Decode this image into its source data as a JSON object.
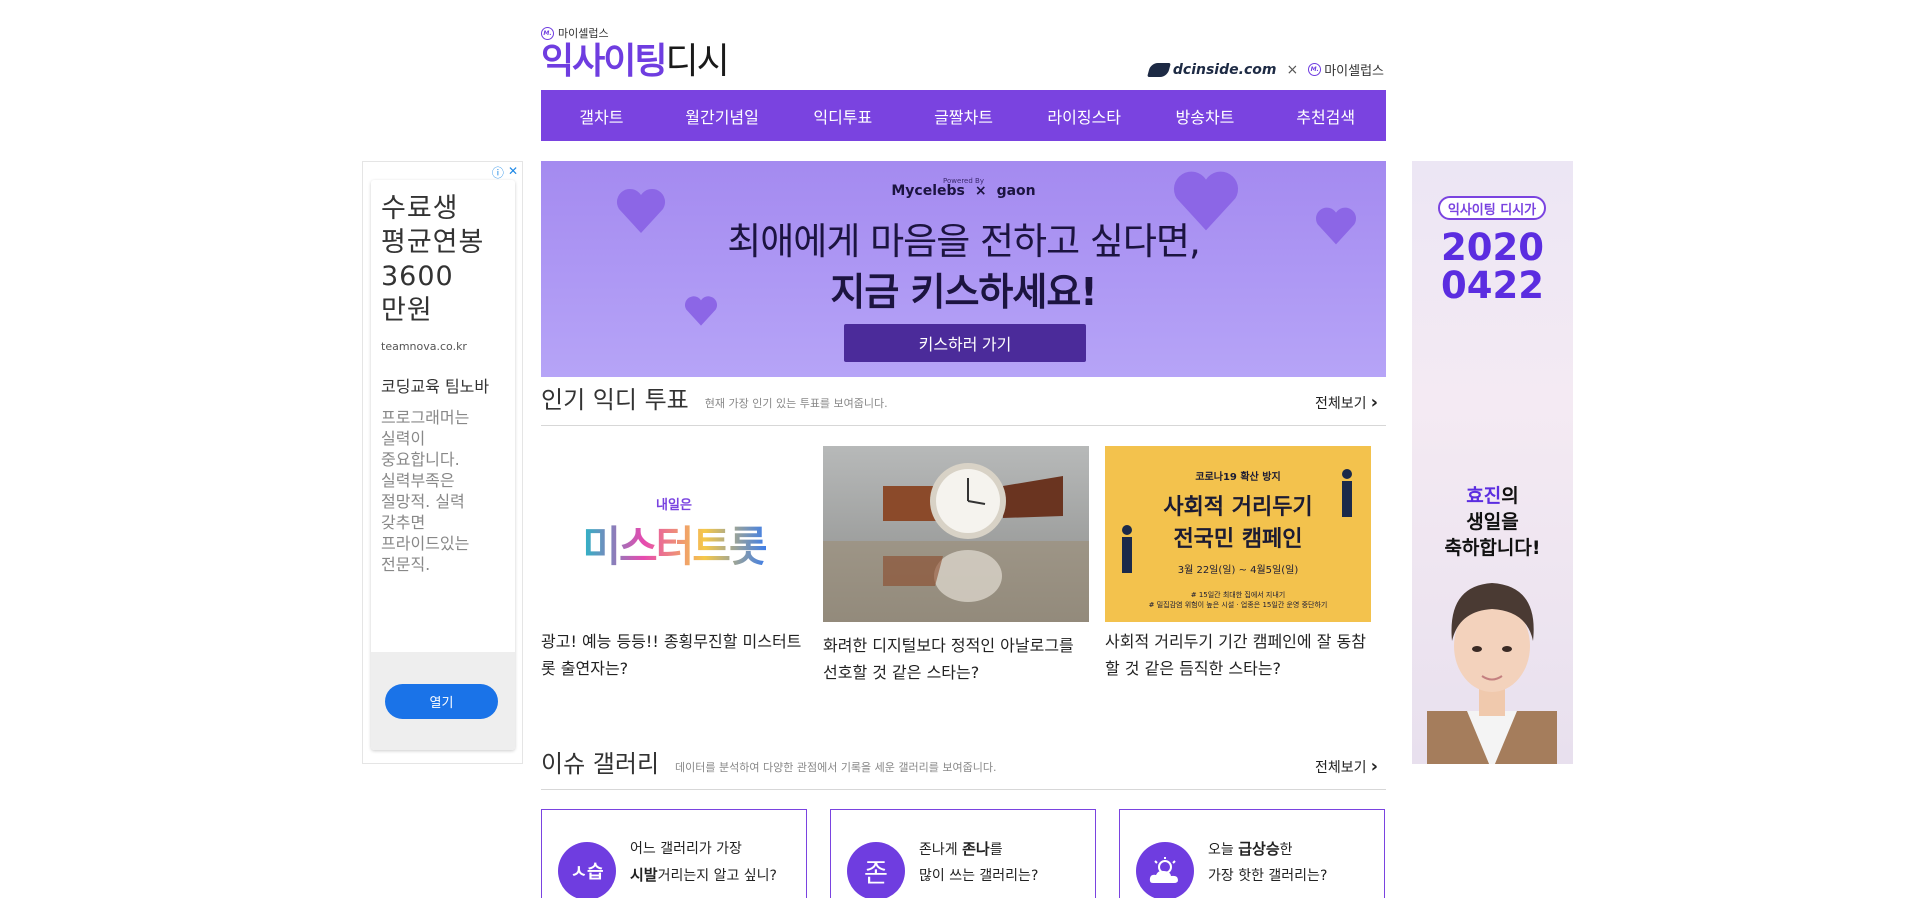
{
  "header": {
    "brand_small": "마이셀럽스",
    "logo_part1": "익사이팅",
    "logo_part2": "디시",
    "partner_dc": "dcinside.com",
    "partner_x": "×",
    "partner_mc": "마이셀럽스",
    "mc_mark": "M."
  },
  "nav": {
    "items": [
      "갤차트",
      "월간기념일",
      "익디투표",
      "글짤차트",
      "라이징스타",
      "방송차트",
      "추천검색"
    ]
  },
  "ad_left": {
    "headline": "수료생\n평균연봉\n3600\n만원",
    "domain": "teamnova.co.kr",
    "title": "코딩교육 팀노바",
    "desc": "프로그래머는\n실력이\n중요합니다.\n실력부족은\n절망적. 실력\n갖추면\n프라이드있는\n전문직.",
    "open_label": "열기",
    "adchoices_i": "ⓘ",
    "adchoices_x": "✕"
  },
  "ad_right": {
    "badge": "익사이팅 디시가",
    "date_line1": "2020",
    "date_line2": "0422",
    "wish_name": "효진",
    "wish_line1_suffix": "의",
    "wish_line2": "생일을",
    "wish_line3": "축하합니다!"
  },
  "banner": {
    "powered": "Powered By",
    "logo1": "Mycelebs",
    "x": "×",
    "logo2": "gaon",
    "line1": "최애에게 마음을 전하고 싶다면,",
    "line2": "지금 키스하세요!",
    "cta": "키스하러 가기"
  },
  "popular_polls": {
    "title": "인기 익디 투표",
    "subtitle": "현재 가장 인기 있는 투표를 보여줍니다.",
    "more": "전체보기",
    "items": [
      {
        "question": "광고! 예능 등등!! 종횡무진할 미스터트롯 출연자는?",
        "thumb_top": "내일은",
        "thumb_main": "미스터트롯"
      },
      {
        "question": "화려한 디지털보다 정적인 아날로그를 선호할 것 같은 스타는?"
      },
      {
        "question": "사회적 거리두기 기간 캠페인에 잘 동참할 것 같은 듬직한 스타는?",
        "thumb_top": "코로나19 확산 방지",
        "thumb_main1": "사회적 거리두기",
        "thumb_main2": "전국민 캠페인",
        "thumb_date": "3월 22일(일) ~ 4월5일(일)",
        "thumb_note1": "# 15일간 최대한 집에서 지내기",
        "thumb_note2": "# 밀집감염 위험이 높은 시설 · 업종은 15일간 운영 중단하기"
      }
    ]
  },
  "issue_gallery": {
    "title": "이슈 갤러리",
    "subtitle": "데이터를 분석하여 다양한 관점에서 기록을 세운 갤러리를 보여줍니다.",
    "more": "전체보기",
    "items": [
      {
        "icon": "ㅅ습",
        "line1": "어느 갤러리가 가장",
        "bold": "시발",
        "line2_rest": "거리는지 알고 싶니?"
      },
      {
        "icon": "존",
        "line1_pre": "존나게 ",
        "bold": "존나",
        "line1_post": "를",
        "line2": "많이 쓰는 갤러리는?"
      },
      {
        "icon": "",
        "line1_pre": "오늘 ",
        "bold": "급상승",
        "line1_post": "한",
        "line2": "가장 핫한 갤러리는?"
      }
    ]
  },
  "colors": {
    "brand_purple": "#7a43e0",
    "banner_bg": "#a48af0"
  }
}
